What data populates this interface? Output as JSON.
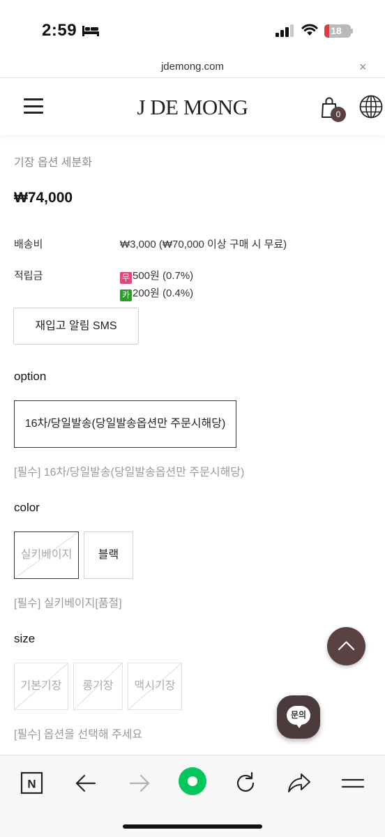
{
  "status": {
    "time": "2:59",
    "battery": "18",
    "battery_level": 0.18
  },
  "browser": {
    "url": "jdemong.com",
    "close_icon": "×"
  },
  "header": {
    "logo": "J DE MONG",
    "cart_count": "0"
  },
  "product": {
    "subtitle": "기장 옵션 세분화",
    "price": "₩74,000",
    "shipping_label": "배송비",
    "shipping_value": "₩3,000 (₩70,000 이상 구매 시 무료)",
    "points_label": "적립금",
    "points": [
      {
        "badge": "무",
        "text": "500원 (0.7%)",
        "color": "#e0457b"
      },
      {
        "badge": "카",
        "text": "200원 (0.4%)",
        "color": "#2f9a2f"
      }
    ],
    "restock_button": "재입고 알림 SMS"
  },
  "options": {
    "option_title": "option",
    "option_value": "16차/당일발송(당일발송옵션만 주문시해당)",
    "option_note": "[필수] 16차/당일발송(당일발송옵션만 주문시해당)",
    "color_title": "color",
    "colors": [
      {
        "label": "실키베이지",
        "selected": true,
        "sold_out": true
      },
      {
        "label": "블랙",
        "selected": false,
        "sold_out": false
      }
    ],
    "color_note": "[필수] 실키베이지[품절]",
    "size_title": "size",
    "sizes": [
      {
        "label": "기본기장",
        "sold_out": true
      },
      {
        "label": "롱기장",
        "sold_out": true
      },
      {
        "label": "맥시기장",
        "sold_out": true
      }
    ],
    "size_note": "[필수] 옵션을 선택해 주세요"
  },
  "floating": {
    "inquiry_label": "문의"
  },
  "colors": {
    "accent": "#5a4142",
    "naver_green": "#03c75a"
  },
  "toolbar": {
    "icons": [
      "naver-n-icon",
      "back-arrow-icon",
      "forward-arrow-icon",
      "green-dot-icon",
      "refresh-icon",
      "share-icon",
      "menu-icon"
    ],
    "naver_letter": "N"
  }
}
